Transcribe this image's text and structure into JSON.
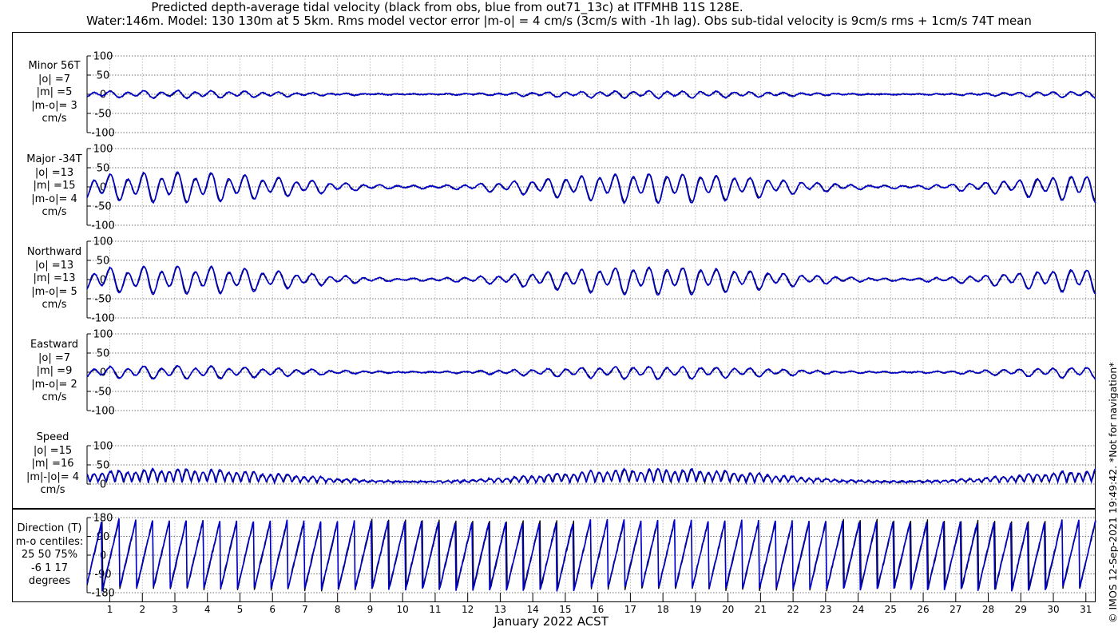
{
  "title_line1": "Predicted depth-average tidal velocity (black from obs, blue from out71_13c) at ITFMHB 11S 128E.",
  "title_line2": "Water:146m. Model: 130 130m at 5 5km. Rms model vector error |m-o| = 4 cm/s (3cm/s with -1h lag). Obs sub-tidal velocity is 9cm/s rms + 1cm/s 74T mean",
  "xlabel": "January 2022 ACST",
  "credit": "© IMOS 12-Sep-2021 19:49:42. *Not for navigation*",
  "panels": [
    {
      "id": "minor",
      "lines": [
        "Minor 56T",
        "|o| =7",
        "|m| =5",
        "|m-o|= 3",
        "cm/s"
      ]
    },
    {
      "id": "major",
      "lines": [
        "Major -34T",
        "|o| =13",
        "|m| =15",
        "|m-o|= 4",
        "cm/s"
      ]
    },
    {
      "id": "north",
      "lines": [
        "Northward",
        "|o| =13",
        "|m| =13",
        "|m-o|= 5",
        "cm/s"
      ]
    },
    {
      "id": "east",
      "lines": [
        "Eastward",
        "|o| =7",
        "|m| =9",
        "|m-o|= 2",
        "cm/s"
      ]
    },
    {
      "id": "speed",
      "lines": [
        "Speed",
        "|o| =15",
        "|m| =16",
        "|m|-|o|= 4",
        "cm/s"
      ]
    },
    {
      "id": "direction",
      "lines": [
        "Direction (T)",
        "m-o centiles:",
        "25  50  75%",
        "-6   1  17",
        "degrees"
      ]
    }
  ],
  "chart_data": [
    {
      "type": "line",
      "panel": "Minor 56T",
      "series": [
        {
          "name": "obs",
          "color": "#000000"
        },
        {
          "name": "out71_13c",
          "color": "#0000cc"
        }
      ],
      "xlim": [
        0.3,
        31.3
      ],
      "ylim": [
        -100,
        100
      ],
      "yticks": [
        -100,
        -50,
        0,
        50,
        100
      ],
      "amplitude_cm_s": 7
    },
    {
      "type": "line",
      "panel": "Major -34T",
      "series": [
        {
          "name": "obs",
          "color": "#000000"
        },
        {
          "name": "out71_13c",
          "color": "#0000cc"
        }
      ],
      "xlim": [
        0.3,
        31.3
      ],
      "ylim": [
        -100,
        100
      ],
      "yticks": [
        -100,
        -50,
        0,
        50,
        100
      ],
      "amplitude_cm_s": 28
    },
    {
      "type": "line",
      "panel": "Northward",
      "series": [
        {
          "name": "obs",
          "color": "#000000"
        },
        {
          "name": "out71_13c",
          "color": "#0000cc"
        }
      ],
      "xlim": [
        0.3,
        31.3
      ],
      "ylim": [
        -100,
        100
      ],
      "yticks": [
        -100,
        -50,
        0,
        50,
        100
      ],
      "amplitude_cm_s": 26
    },
    {
      "type": "line",
      "panel": "Eastward",
      "series": [
        {
          "name": "obs",
          "color": "#000000"
        },
        {
          "name": "out71_13c",
          "color": "#0000cc"
        }
      ],
      "xlim": [
        0.3,
        31.3
      ],
      "ylim": [
        -100,
        100
      ],
      "yticks": [
        -100,
        -50,
        0,
        50,
        100
      ],
      "amplitude_cm_s": 12
    },
    {
      "type": "line",
      "panel": "Speed",
      "series": [
        {
          "name": "obs",
          "color": "#000000"
        },
        {
          "name": "out71_13c",
          "color": "#0000cc"
        }
      ],
      "xlim": [
        0.3,
        31.3
      ],
      "ylim": [
        0,
        100
      ],
      "yticks": [
        0,
        50,
        100
      ],
      "amplitude_cm_s": 30
    },
    {
      "type": "line",
      "panel": "Direction (T)",
      "series": [
        {
          "name": "obs",
          "color": "#000000"
        },
        {
          "name": "out71_13c",
          "color": "#0000cc"
        }
      ],
      "xlim": [
        0.3,
        31.3
      ],
      "ylim": [
        -180,
        180
      ],
      "yticks": [
        -180,
        -90,
        0,
        90,
        180
      ]
    }
  ],
  "x_tick_labels": [
    "1",
    "2",
    "3",
    "4",
    "5",
    "6",
    "7",
    "8",
    "9",
    "10",
    "11",
    "12",
    "13",
    "14",
    "15",
    "16",
    "17",
    "18",
    "19",
    "20",
    "21",
    "22",
    "23",
    "24",
    "25",
    "26",
    "27",
    "28",
    "29",
    "30",
    "31"
  ],
  "y_tick_labels_velocity": [
    "100",
    "50",
    "0",
    "-50",
    "-100"
  ],
  "y_tick_labels_speed": [
    "100",
    "50",
    "0"
  ],
  "y_tick_labels_direction": [
    "180",
    "90",
    "0",
    "-90",
    "-180"
  ]
}
